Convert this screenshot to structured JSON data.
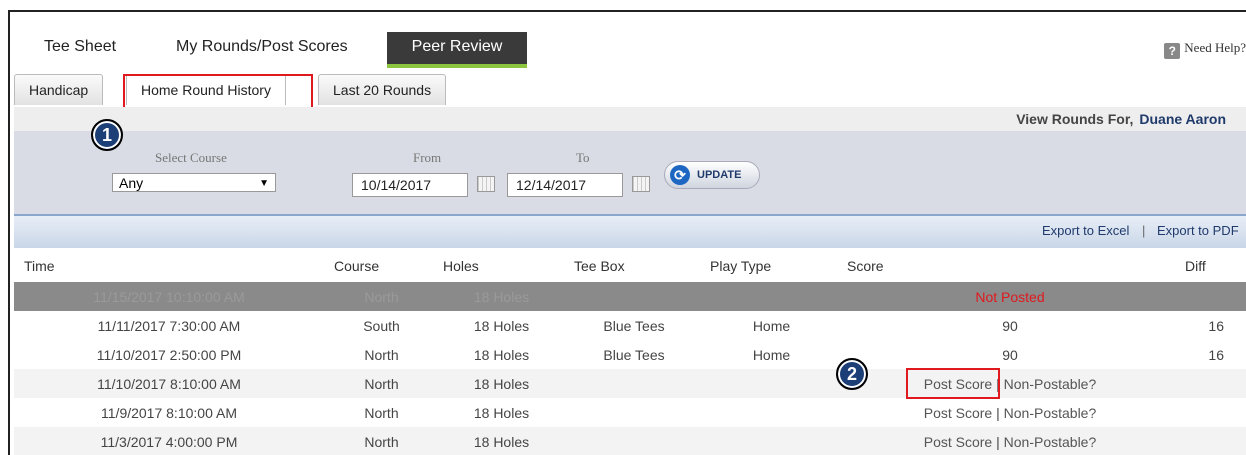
{
  "nav": {
    "tee_sheet": "Tee Sheet",
    "my_rounds": "My Rounds/Post Scores",
    "peer_review": "Peer Review",
    "help": "Need Help?"
  },
  "tabs": [
    "Handicap",
    "Home Round History",
    "Last 20 Rounds"
  ],
  "view_rounds": {
    "label": "View Rounds For,",
    "name": "Duane Aaron"
  },
  "filter": {
    "course_label": "Select Course",
    "course_value": "Any",
    "from_label": "From",
    "from_value": "10/14/2017",
    "to_label": "To",
    "to_value": "12/14/2017",
    "update_label": "UPDATE"
  },
  "export": {
    "excel": "Export to Excel",
    "separator": "|",
    "pdf": "Export to PDF"
  },
  "table": {
    "headers": [
      "Time",
      "Course",
      "Holes",
      "Tee Box",
      "Play Type",
      "Score",
      "Diff"
    ],
    "rows": [
      {
        "time": "11/15/2017 10:10:00 AM",
        "course": "North",
        "holes": "18 Holes",
        "tee": "",
        "play": "",
        "score": "Not Posted",
        "diff": ""
      },
      {
        "time": "11/11/2017 7:30:00 AM",
        "course": "South",
        "holes": "18 Holes",
        "tee": "Blue Tees",
        "play": "Home",
        "score": "90",
        "diff": "16"
      },
      {
        "time": "11/10/2017 2:50:00 PM",
        "course": "North",
        "holes": "18 Holes",
        "tee": "Blue Tees",
        "play": "Home",
        "score": "90",
        "diff": "16"
      },
      {
        "time": "11/10/2017 8:10:00 AM",
        "course": "North",
        "holes": "18 Holes",
        "tee": "",
        "play": "",
        "score": "",
        "diff": ""
      },
      {
        "time": "11/9/2017 8:10:00 AM",
        "course": "North",
        "holes": "18 Holes",
        "tee": "",
        "play": "",
        "score": "",
        "diff": ""
      },
      {
        "time": "11/3/2017 4:00:00 PM",
        "course": "North",
        "holes": "18 Holes",
        "tee": "",
        "play": "",
        "score": "",
        "diff": ""
      }
    ],
    "post_score": "Post Score",
    "link_sep": "|",
    "non_postable": "Non-Postable?"
  },
  "badges": [
    "1",
    "2"
  ],
  "colors": {
    "highlight": "#e0191f",
    "accent_green": "#8cc63f",
    "badge": "#1c3f78",
    "link": "#1f3a6b"
  }
}
